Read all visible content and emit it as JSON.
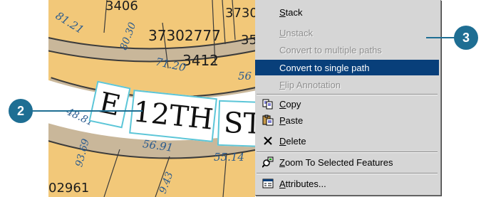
{
  "map": {
    "parcel_numbers": [
      "3406",
      "3730",
      "37302777",
      "3412",
      "35",
      "02961"
    ],
    "dimensions": [
      "81.21",
      "80.30",
      "71.20",
      "56",
      "48.81",
      "93.69",
      "56.91",
      "55.14",
      "9.43"
    ],
    "annotation_words": [
      "E",
      "12TH",
      "ST"
    ]
  },
  "context_menu": {
    "items": [
      {
        "label": "Stack",
        "underline": "S",
        "rest": "tack",
        "state": "enabled",
        "icon": ""
      },
      {
        "label": "Unstack",
        "underline": "U",
        "rest": "nstack",
        "state": "disabled",
        "icon": ""
      },
      {
        "label": "Convert to multiple paths",
        "state": "disabled",
        "icon": ""
      },
      {
        "label": "Convert to single path",
        "state": "selected",
        "icon": ""
      },
      {
        "label": "Flip Annotation",
        "underline": "F",
        "rest": "lip Annotation",
        "state": "disabled",
        "icon": ""
      },
      {
        "label": "Copy",
        "underline": "C",
        "rest": "opy",
        "state": "enabled",
        "icon": "copy-icon"
      },
      {
        "label": "Paste",
        "underline": "P",
        "rest": "aste",
        "state": "enabled",
        "icon": "paste-icon"
      },
      {
        "label": "Delete",
        "underline": "D",
        "rest": "elete",
        "state": "enabled",
        "icon": "delete-icon"
      },
      {
        "label": "Zoom To Selected Features",
        "underline": "Z",
        "rest": "oom To Selected Features",
        "state": "enabled",
        "icon": "zoom-to-selected-icon"
      },
      {
        "label": "Attributes...",
        "underline": "A",
        "rest": "ttributes...",
        "state": "enabled",
        "icon": "attributes-icon"
      }
    ]
  },
  "callouts": {
    "two": "2",
    "three": "3"
  },
  "colors": {
    "parcel_fill": "#f2c879",
    "road": "#c9b79a",
    "selection_outline": "#5cc6d8",
    "menu_highlight": "#083f7a",
    "callout": "#1e6e93"
  }
}
